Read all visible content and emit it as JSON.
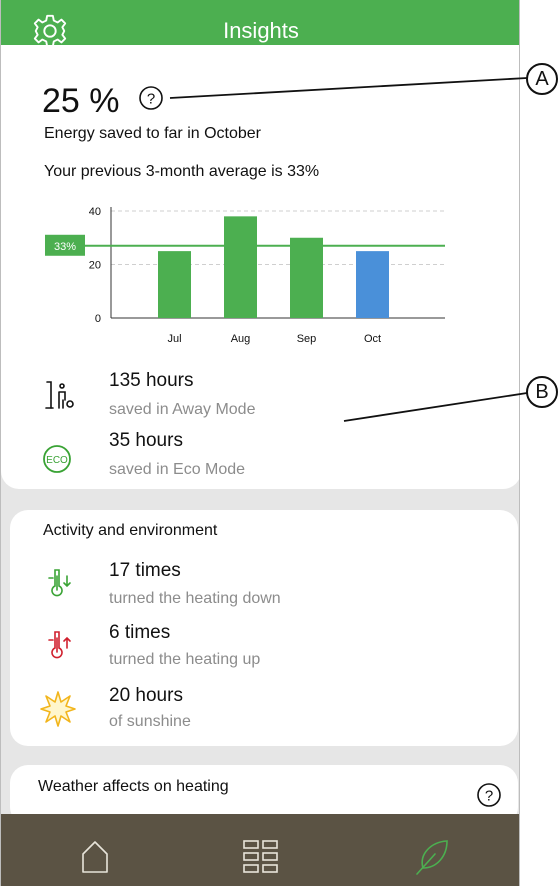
{
  "header": {
    "title": "Insights",
    "settings_icon": "gear-icon"
  },
  "summary": {
    "percent": "25 %",
    "help_icon": "question-circle-icon",
    "energy_text": "Energy saved to far in October",
    "average_text": "Your previous 3-month average is 33%"
  },
  "chart_data": {
    "type": "bar",
    "categories": [
      "Jul",
      "Aug",
      "Sep",
      "Oct"
    ],
    "values": [
      25,
      38,
      30,
      25
    ],
    "bar_colors": [
      "#4caf50",
      "#4caf50",
      "#4caf50",
      "#4a90d9"
    ],
    "yticks": [
      0,
      20,
      40
    ],
    "ylim": [
      0,
      40
    ],
    "average_line": {
      "value": 27,
      "label": "33%",
      "color": "#4caf50"
    },
    "grid": "dashed-horizontal"
  },
  "savings": [
    {
      "icon": "away-mode-icon",
      "value": "135 hours",
      "label": "saved in Away Mode"
    },
    {
      "icon": "eco-icon",
      "value": "35 hours",
      "label": "saved in Eco Mode"
    }
  ],
  "activity": {
    "title": "Activity and environment",
    "items": [
      {
        "icon": "thermometer-down-icon",
        "value": "17 times",
        "label": "turned the heating down"
      },
      {
        "icon": "thermometer-up-icon",
        "value": "6 times",
        "label": "turned the heating up"
      },
      {
        "icon": "sun-icon",
        "value": "20 hours",
        "label": "of sunshine"
      }
    ]
  },
  "weather": {
    "title": "Weather affects on heating",
    "help_icon": "question-circle-icon"
  },
  "nav": {
    "items": [
      "home-icon",
      "grid-icon",
      "leaf-icon"
    ]
  },
  "callouts": {
    "a": "A",
    "b": "B"
  },
  "colors": {
    "brand_green": "#4caf50",
    "nav_bg": "#5b5344",
    "oct_blue": "#4a90d9",
    "thermo_down": "#3aa335",
    "thermo_up": "#d0202e",
    "sun": "#f2b51c"
  }
}
